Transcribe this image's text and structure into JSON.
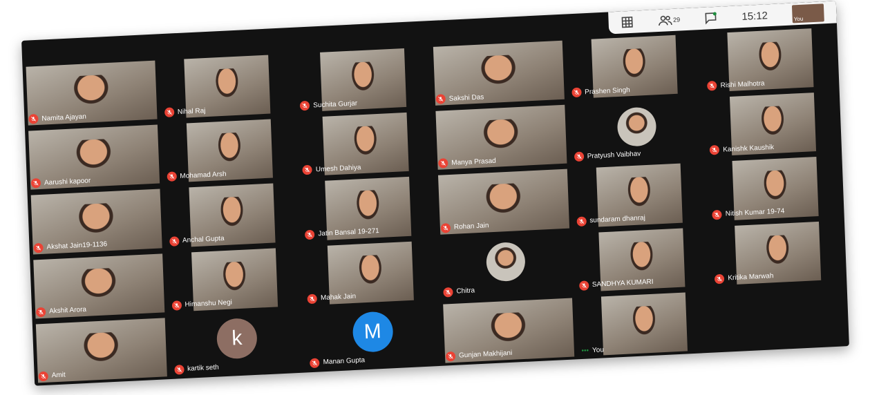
{
  "topbar": {
    "people_count": "29",
    "time": "15:12",
    "self_label": "You"
  },
  "participants": [
    {
      "name": "Namita Ajayan",
      "kind": "video"
    },
    {
      "name": "Nihal Raj",
      "kind": "video"
    },
    {
      "name": "Suchita Gurjar",
      "kind": "video"
    },
    {
      "name": "Sakshi Das",
      "kind": "video"
    },
    {
      "name": "Prashen Singh",
      "kind": "video"
    },
    {
      "name": "Rishi Malhotra",
      "kind": "video"
    },
    {
      "name": "Aarushi kapoor",
      "kind": "video"
    },
    {
      "name": "Mohamad Arsh",
      "kind": "video"
    },
    {
      "name": "Umesh Dahiya",
      "kind": "video"
    },
    {
      "name": "Manya Prasad",
      "kind": "video"
    },
    {
      "name": "Pratyush Vaibhav",
      "kind": "photo"
    },
    {
      "name": "Kanishk Kaushik",
      "kind": "video"
    },
    {
      "name": "Akshat Jain19-1136",
      "kind": "video"
    },
    {
      "name": "Anchal Gupta",
      "kind": "video"
    },
    {
      "name": "Jatin Bansal 19-271",
      "kind": "video"
    },
    {
      "name": "Rohan Jain",
      "kind": "video"
    },
    {
      "name": "sundaram dhanraj",
      "kind": "video"
    },
    {
      "name": "Nitish Kumar 19-74",
      "kind": "video"
    },
    {
      "name": "Akshit Arora",
      "kind": "video"
    },
    {
      "name": "Himanshu Negi",
      "kind": "video"
    },
    {
      "name": "Mahak Jain",
      "kind": "video"
    },
    {
      "name": "Chitra",
      "kind": "photo"
    },
    {
      "name": "SANDHYA KUMARI",
      "kind": "video"
    },
    {
      "name": "Kritika Marwah",
      "kind": "video"
    },
    {
      "name": "Amit",
      "kind": "video"
    },
    {
      "name": "kartik seth",
      "kind": "avatar",
      "initial": "k",
      "color": "#8d6e63"
    },
    {
      "name": "Manan Gupta",
      "kind": "avatar",
      "initial": "M",
      "color": "#1e88e5"
    },
    {
      "name": "Gunjan Makhijani",
      "kind": "video"
    },
    {
      "name": "You",
      "kind": "self"
    }
  ]
}
